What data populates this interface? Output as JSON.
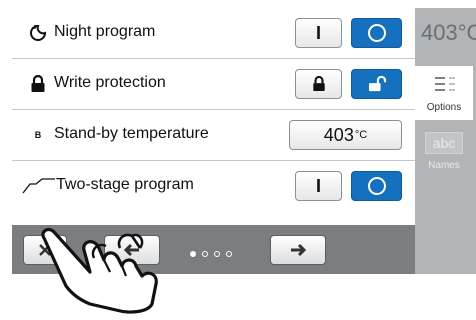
{
  "rows": [
    {
      "icon": "night-icon",
      "label": "Night program",
      "on_label": "I"
    },
    {
      "icon": "lock-icon",
      "label": "Write protection"
    },
    {
      "icon": "b-icon",
      "icon_text": "B",
      "label": "Stand-by temperature",
      "value": "403",
      "unit": "°C"
    },
    {
      "icon": "two-stage-icon",
      "label": "Two-stage program",
      "on_label": "I"
    }
  ],
  "sidebar": {
    "temp_peek": "403°C",
    "tabs": [
      {
        "label": "Options",
        "icon": "options-icon",
        "active": true
      },
      {
        "label": "Names",
        "icon": "abc-icon",
        "icon_text": "abc",
        "active": false
      }
    ]
  },
  "pager": {
    "pages": 4,
    "current": 1
  },
  "colors": {
    "accent": "#1570bd",
    "frame": "#7b7d80",
    "sidebar": "#b2b4b6"
  }
}
